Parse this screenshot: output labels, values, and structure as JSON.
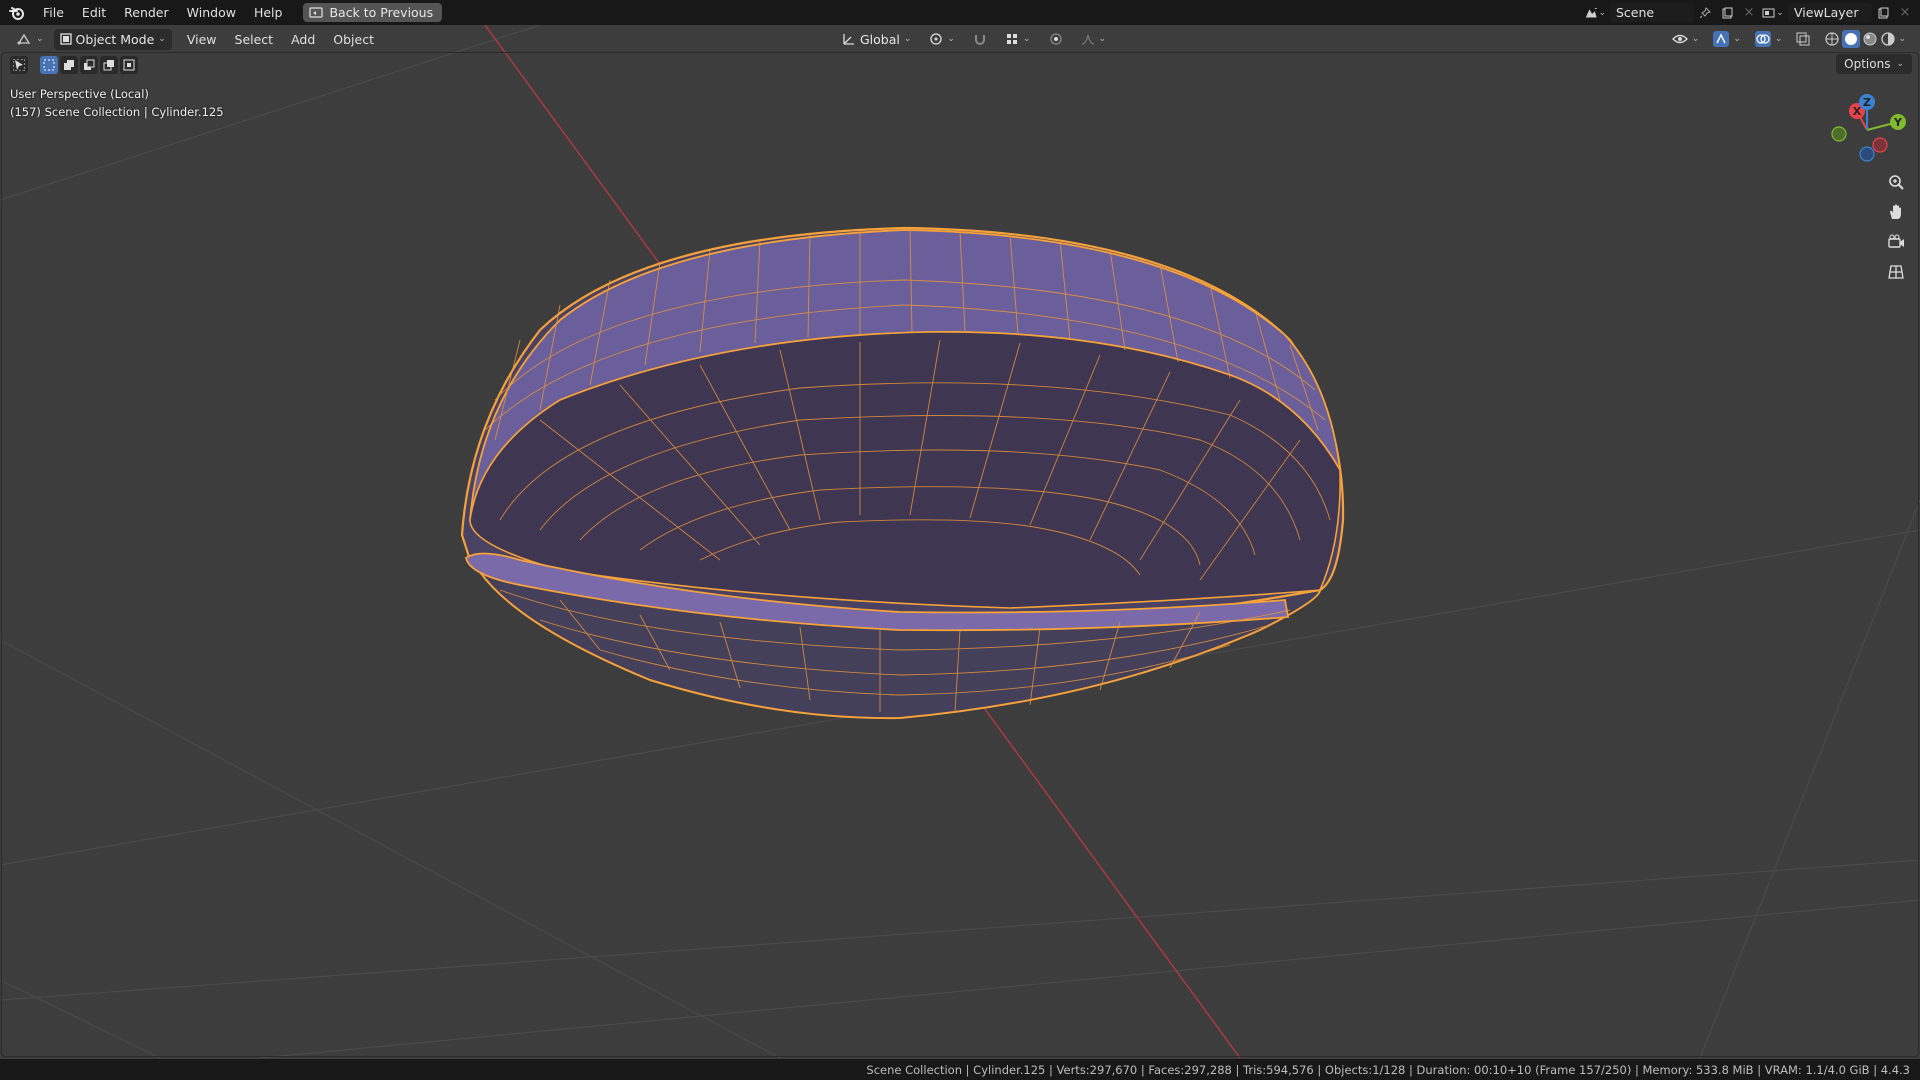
{
  "top_menu": [
    "File",
    "Edit",
    "Render",
    "Window",
    "Help"
  ],
  "back_button": "Back to Previous",
  "scene": {
    "name": "Scene"
  },
  "view_layer": {
    "name": "ViewLayer"
  },
  "header": {
    "mode": "Object Mode",
    "menus": [
      "View",
      "Select",
      "Add",
      "Object"
    ],
    "transform_orientation": "Global",
    "options_label": "Options"
  },
  "viewport": {
    "perspective_label": "User Perspective (Local)",
    "collection_label": "(157) Scene Collection | Cylinder.125"
  },
  "gizmo": {
    "x": "X",
    "y": "Y",
    "z": "Z"
  },
  "status_bar": {
    "text": "Scene Collection | Cylinder.125 | Verts:297,670 | Faces:297,288 | Tris:594,576 | Objects:1/128 | Duration: 00:10+10 (Frame 157/250) | Memory: 533.8 MiB | VRAM: 1.1/4.0 GiB | 4.4.3"
  },
  "colors": {
    "background": "#3d3d3d",
    "selection_outline": "#f5a23a",
    "mesh_fill": "#4e4466",
    "x_axis": "#e8434a",
    "y_axis": "#7fbb2c",
    "z_axis": "#3c82d4"
  }
}
